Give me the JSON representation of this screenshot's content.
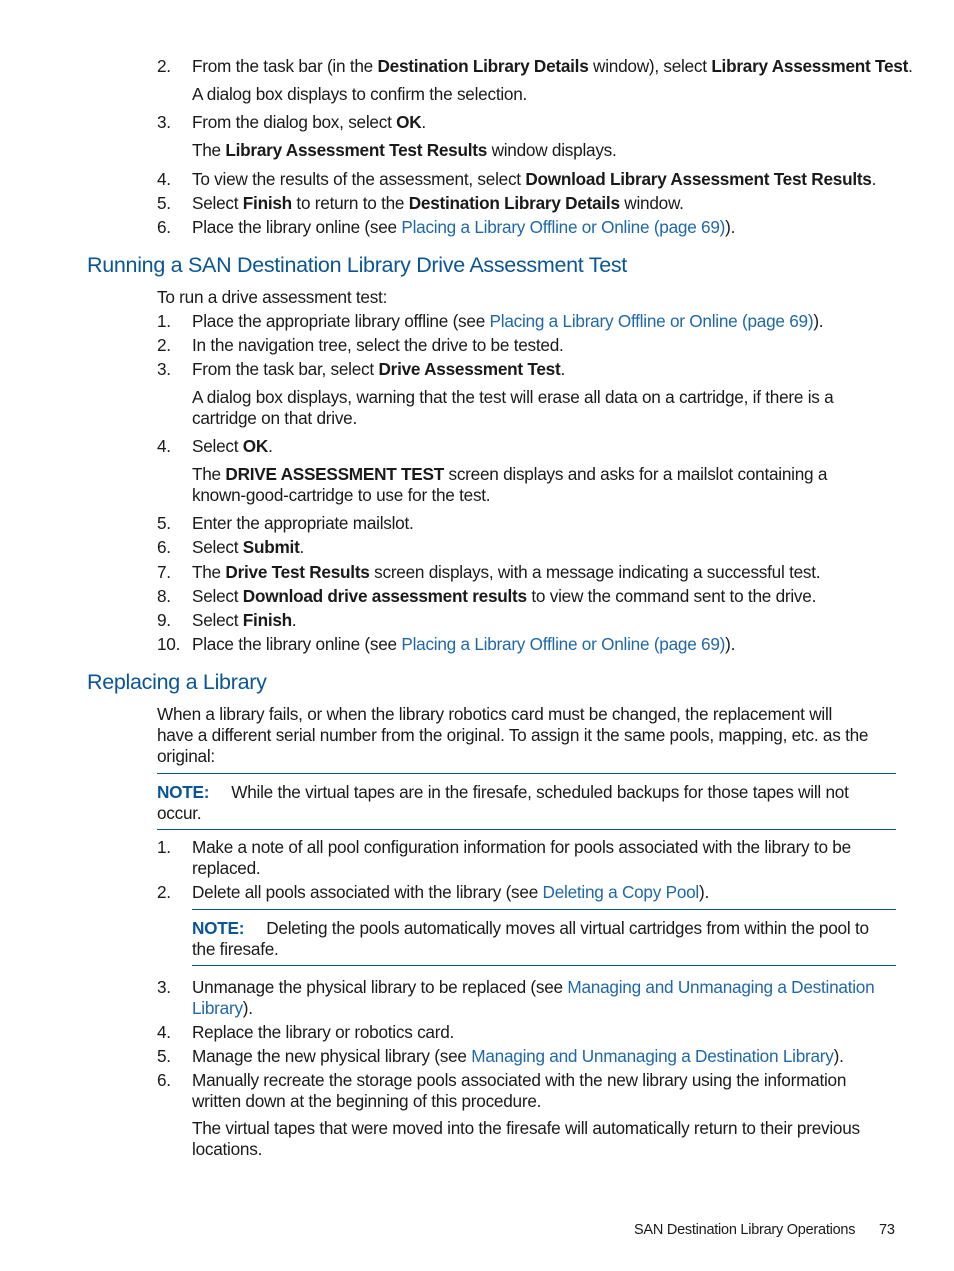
{
  "section1": {
    "steps": [
      {
        "n": "2.",
        "pre": "From the task bar (in the ",
        "b1": "Destination Library Details",
        "mid": " window), select ",
        "b2": "Library Assessment Test",
        "post": "."
      },
      {
        "sub": "A dialog box displays to confirm the selection."
      },
      {
        "n": "3.",
        "pre": "From the dialog box, select ",
        "b1": "OK",
        "post": "."
      },
      {
        "sub_pre": "The ",
        "sub_b": "Library Assessment Test Results",
        "sub_post": " window displays."
      },
      {
        "n": "4.",
        "pre": "To view the results of the assessment, select ",
        "b1": "Download Library Assessment Test Results",
        "post": "."
      },
      {
        "n": "5.",
        "pre": "Select ",
        "b1": "Finish",
        "mid": " to return to the ",
        "b2": "Destination Library Details",
        "post": " window."
      },
      {
        "n": "6.",
        "pre": "Place the library online (see ",
        "link": "Placing a Library Offline or Online (page 69)",
        "post": ")."
      }
    ]
  },
  "section2": {
    "heading": "Running a SAN Destination Library Drive Assessment Test",
    "intro": "To run a drive assessment test:",
    "steps": [
      {
        "n": "1.",
        "pre": "Place the appropriate library offline (see ",
        "link": "Placing a Library Offline or Online (page 69)",
        "post": ")."
      },
      {
        "n": "2.",
        "pre": "In the navigation tree, select the drive to be tested."
      },
      {
        "n": "3.",
        "pre": "From the task bar, select ",
        "b1": "Drive Assessment Test",
        "post": "."
      },
      {
        "sub1": "A dialog box displays, warning that the test will erase all data on a cartridge, if there is a",
        "sub2": "cartridge on that drive."
      },
      {
        "n": "4.",
        "pre": "Select ",
        "b1": "OK",
        "post": "."
      },
      {
        "sub_pre": "The ",
        "sub_b": "DRIVE ASSESSMENT TEST",
        "sub_post": " screen displays and asks for a mailslot containing a",
        "sub2": "known-good-cartridge to use for the test."
      },
      {
        "n": "5.",
        "pre": "Enter the appropriate mailslot."
      },
      {
        "n": "6.",
        "pre": "Select ",
        "b1": "Submit",
        "post": "."
      },
      {
        "n": "7.",
        "pre": "The ",
        "b1": "Drive Test Results",
        "post": " screen displays, with a message indicating a successful test."
      },
      {
        "n": "8.",
        "pre": "Select ",
        "b1": "Download drive assessment results",
        "post": " to view the command sent to the drive."
      },
      {
        "n": "9.",
        "pre": "Select ",
        "b1": "Finish",
        "post": "."
      },
      {
        "n": "10.",
        "pre": "Place the library online (see ",
        "link": "Placing a Library Offline or Online (page 69)",
        "post": ")."
      }
    ]
  },
  "section3": {
    "heading": "Replacing a Library",
    "intro": [
      "When a library fails, or when the library robotics card must be changed, the replacement will",
      "have a different serial number from the original. To assign it the same pools, mapping, etc. as the",
      "original:"
    ],
    "note1": {
      "label": "NOTE:",
      "line1": "While the virtual tapes are in the firesafe, scheduled backups for those tapes will not",
      "line2": "occur."
    },
    "steps": [
      {
        "n": "1.",
        "line1": "Make a note of all pool configuration information for pools associated with the library to be",
        "line2": "replaced."
      },
      {
        "n": "2.",
        "pre": "Delete all pools associated with the library (see ",
        "link": "Deleting a Copy Pool",
        "post": ")."
      },
      {
        "n": "3.",
        "pre": "Unmanage the physical library to be replaced (see ",
        "link": "Managing and Unmanaging a Destination",
        "link2": "Library",
        "post": ")."
      },
      {
        "n": "4.",
        "pre": "Replace the library or robotics card."
      },
      {
        "n": "5.",
        "pre": "Manage the new physical library (see ",
        "link": "Managing and Unmanaging a Destination Library",
        "post": ")."
      },
      {
        "n": "6.",
        "line1": "Manually recreate the storage pools associated with the new library using the information",
        "line2": "written down at the beginning of this procedure."
      }
    ],
    "note2": {
      "label": "NOTE:",
      "line1": "Deleting the pools automatically moves all virtual cartridges from within the pool to",
      "line2": "the firesafe."
    },
    "final": [
      "The virtual tapes that were moved into the firesafe will automatically return to their previous",
      "locations."
    ]
  },
  "footer": {
    "title": "SAN Destination Library Operations",
    "page": "73"
  },
  "colors": {
    "heading": "#0a5596",
    "link": "#1f68a8",
    "text": "#1a1a1a"
  }
}
